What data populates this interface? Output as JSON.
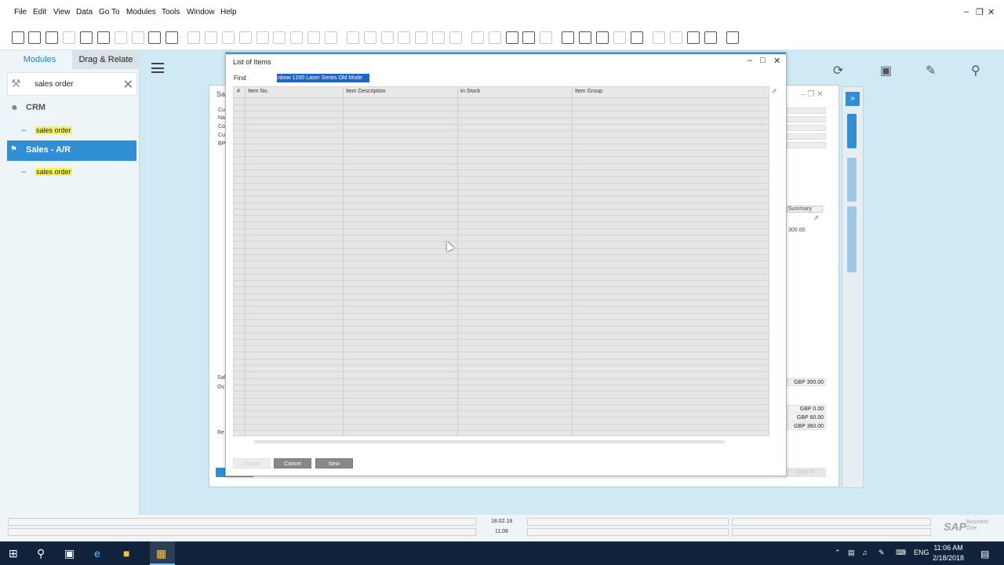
{
  "menubar": {
    "items": [
      "File",
      "Edit",
      "View",
      "Data",
      "Go To",
      "Modules",
      "Tools",
      "Window",
      "Help"
    ]
  },
  "leftpanel": {
    "tabs": {
      "modules": "Modules",
      "drag_relate": "Drag & Relate"
    },
    "search_value": "sales order",
    "tree": {
      "crm": "CRM",
      "crm_result": "sales order",
      "sales_ar": "Sales - A/R",
      "sales_result": "sales order"
    }
  },
  "bg_window": {
    "frag_left": [
      "Cu",
      "Na",
      "Co",
      "Cu",
      "BP"
    ],
    "title_frag": "Sal",
    "summary_label": "Summary",
    "amount_top": "300.00",
    "totals": [
      "GBP 300.00",
      "GBP 0.00",
      "GBP 60.00",
      "GBP 360.00"
    ],
    "left_lower_frag": [
      "Sal",
      "Ov",
      "Re"
    ],
    "copy_to": "Copy To"
  },
  "dialog": {
    "title": "List of Items",
    "find_label": "Find",
    "find_value": "nbow 1200 Laser Series Old Mode",
    "columns": [
      "#",
      "Item No.",
      "Item Description",
      "In Stock",
      "Item Group"
    ],
    "buttons": {
      "choose": "Choose",
      "cancel": "Cancel",
      "new": "New"
    }
  },
  "statusbar": {
    "date": "18.02.18",
    "time": "11:06",
    "brand": "SAP",
    "brand_sub1": "Business",
    "brand_sub2": "One"
  },
  "taskbar": {
    "language": "ENG",
    "clock_time": "11:06 AM",
    "clock_date": "2/18/2018"
  }
}
